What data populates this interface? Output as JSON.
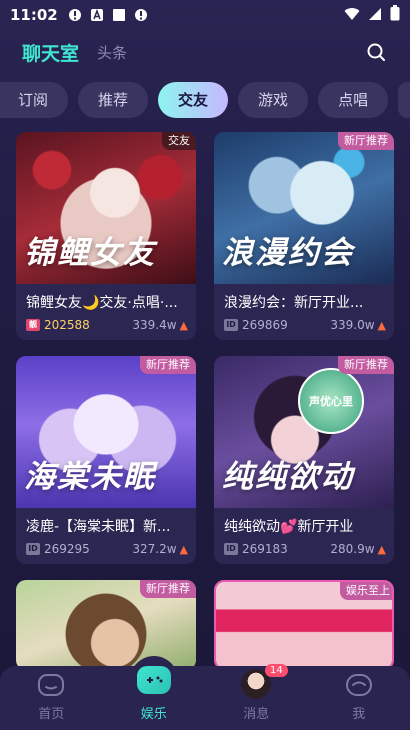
{
  "status_bar": {
    "time": "11:02",
    "notif_icons": [
      "alert-circle-icon",
      "app-a-icon",
      "square-icon",
      "alert-circle-icon"
    ],
    "right_icons": [
      "wifi-icon",
      "signal-icon",
      "battery-icon"
    ]
  },
  "header": {
    "title": "聊天室",
    "subtitle": "头条",
    "accent_color": "#3fe6d0"
  },
  "categories": [
    {
      "label": "订阅",
      "active": false
    },
    {
      "label": "推荐",
      "active": false
    },
    {
      "label": "交友",
      "active": true
    },
    {
      "label": "游戏",
      "active": false
    },
    {
      "label": "点唱",
      "active": false
    }
  ],
  "rooms": [
    {
      "art_text": "锦鲤女友",
      "badge": "交友",
      "badge_color": "#333333",
      "title": "锦鲤女友🌙交友·点唱·...",
      "id_style": "gold",
      "id_icon": "靓",
      "room_id": "202588",
      "heat": "339.4w"
    },
    {
      "art_text": "浪漫约会",
      "badge": "新厅推荐",
      "badge_color": "#c25ba0",
      "title": "浪漫约会：新厅开业...",
      "id_style": "plain",
      "id_icon": "ID",
      "room_id": "269869",
      "heat": "339.0w"
    },
    {
      "art_text": "海棠未眠",
      "badge": "新厅推荐",
      "badge_color": "#c25ba0",
      "title": "凌鹿-【海棠未眠】新...",
      "id_style": "plain",
      "id_icon": "ID",
      "room_id": "269295",
      "heat": "327.2w"
    },
    {
      "art_text": "纯纯欲动",
      "badge": "新厅推荐",
      "badge_color": "#c25ba0",
      "title": "纯纯欲动💕新厅开业",
      "id_style": "plain",
      "id_icon": "ID",
      "room_id": "269183",
      "heat": "280.9w"
    },
    {
      "art_text": "",
      "badge": "新厅推荐",
      "badge_color": "#c25ba0",
      "title": "",
      "id_style": "plain",
      "id_icon": "",
      "room_id": "",
      "heat": ""
    },
    {
      "art_text": "",
      "badge": "娱乐至上",
      "badge_color": "#c25ba0",
      "title": "",
      "id_style": "plain",
      "id_icon": "",
      "room_id": "",
      "heat": ""
    }
  ],
  "logo_text": "声优心里",
  "bottom_nav": [
    {
      "label": "首页",
      "icon": "home-icon",
      "active": false
    },
    {
      "label": "娱乐",
      "icon": "gamepad-icon",
      "active": true
    },
    {
      "label": "消息",
      "icon": "avatar",
      "active": false,
      "badge": "14"
    },
    {
      "label": "我",
      "icon": "profile-icon",
      "active": false
    }
  ]
}
